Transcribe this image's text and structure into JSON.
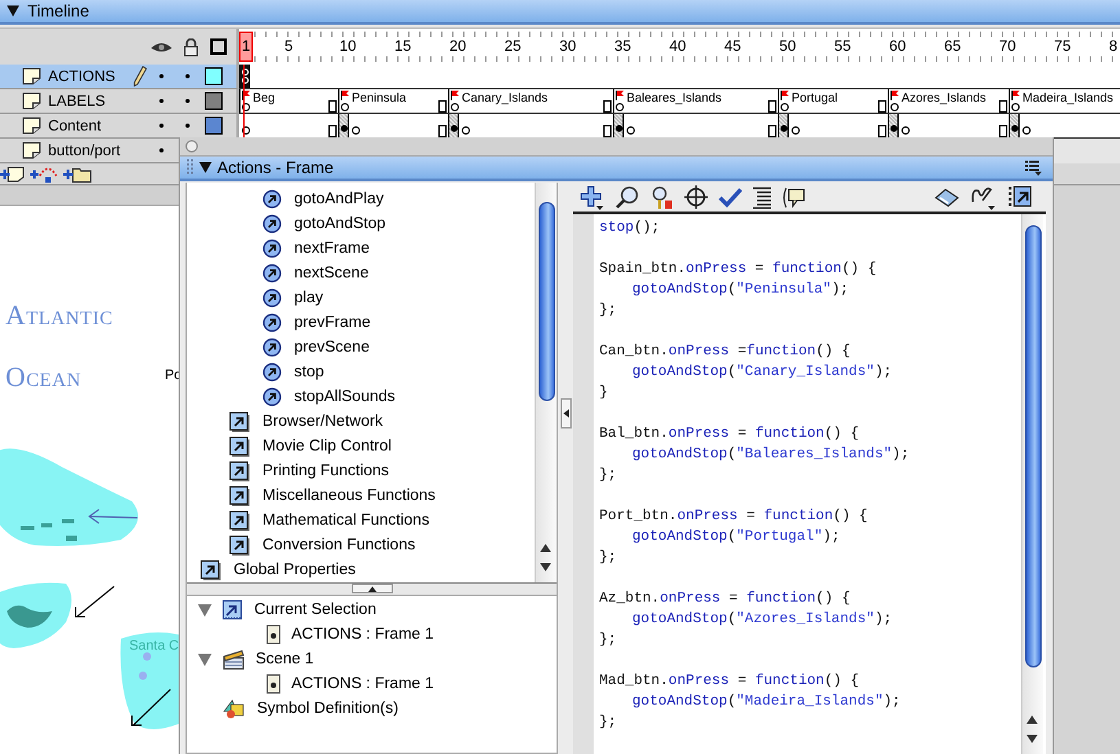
{
  "timeline": {
    "title": "Timeline",
    "ruler": [
      {
        "label": "1",
        "selected": true
      },
      {
        "label": "5",
        "selected": false
      },
      {
        "label": "10",
        "selected": false
      },
      {
        "label": "15",
        "selected": false
      },
      {
        "label": "20",
        "selected": false
      },
      {
        "label": "25",
        "selected": false
      },
      {
        "label": "30",
        "selected": false
      },
      {
        "label": "35",
        "selected": false
      },
      {
        "label": "40",
        "selected": false
      },
      {
        "label": "45",
        "selected": false
      },
      {
        "label": "50",
        "selected": false
      },
      {
        "label": "55",
        "selected": false
      },
      {
        "label": "60",
        "selected": false
      },
      {
        "label": "65",
        "selected": false
      },
      {
        "label": "70",
        "selected": false
      },
      {
        "label": "75",
        "selected": false
      },
      {
        "label": "8",
        "selected": false
      }
    ],
    "layers": [
      {
        "name": "ACTIONS",
        "selected": true,
        "editing": true,
        "covered": false,
        "color": "#80ffff",
        "keyframes": [
          {
            "kind": "action"
          }
        ]
      },
      {
        "name": "LABELS",
        "selected": false,
        "editing": false,
        "covered": false,
        "color": "#808080",
        "keyframes": [
          {
            "kind": "label",
            "label": "Beg"
          },
          {
            "kind": "label",
            "label": "Peninsula"
          },
          {
            "kind": "label",
            "label": "Canary_Islands"
          },
          {
            "kind": "label",
            "label": "Baleares_Islands"
          },
          {
            "kind": "label",
            "label": "Portugal"
          },
          {
            "kind": "label",
            "label": "Azores_Islands"
          },
          {
            "kind": "label",
            "label": "Madeira_Islands"
          }
        ]
      },
      {
        "name": "Content",
        "selected": false,
        "editing": false,
        "covered": false,
        "color": "#5b86d0",
        "keyframes": [
          {
            "kind": "empty"
          },
          {
            "kind": "filled"
          },
          {
            "kind": "empty"
          },
          {
            "kind": "filled"
          },
          {
            "kind": "empty"
          },
          {
            "kind": "filled"
          },
          {
            "kind": "empty"
          },
          {
            "kind": "filled"
          },
          {
            "kind": "empty"
          },
          {
            "kind": "filled"
          },
          {
            "kind": "empty"
          },
          {
            "kind": "filled"
          },
          {
            "kind": "empty"
          }
        ]
      },
      {
        "name": "button/port",
        "selected": false,
        "editing": false,
        "covered": true
      }
    ]
  },
  "stage": {
    "labels": [
      {
        "text": "Atlantic",
        "kind": "ocean"
      },
      {
        "text": "Ocean",
        "kind": "ocean"
      },
      {
        "text": "Po",
        "kind": "place"
      },
      {
        "text": "Santa C",
        "kind": "island"
      }
    ]
  },
  "actions_window": {
    "title": "Actions - Frame",
    "toolbox": [
      {
        "children": [
          {
            "children": [
              {
                "label": "gotoAndPlay",
                "kind": "function"
              },
              {
                "label": "gotoAndStop",
                "kind": "function"
              },
              {
                "label": "nextFrame",
                "kind": "function"
              },
              {
                "label": "nextScene",
                "kind": "function"
              },
              {
                "label": "play",
                "kind": "function"
              },
              {
                "label": "prevFrame",
                "kind": "function"
              },
              {
                "label": "prevScene",
                "kind": "function"
              },
              {
                "label": "stop",
                "kind": "function"
              },
              {
                "label": "stopAllSounds",
                "kind": "function"
              }
            ]
          },
          {
            "label": "Browser/Network",
            "kind": "category"
          },
          {
            "label": "Movie Clip Control",
            "kind": "category"
          },
          {
            "label": "Printing Functions",
            "kind": "category"
          },
          {
            "label": "Miscellaneous Functions",
            "kind": "category"
          },
          {
            "label": "Mathematical Functions",
            "kind": "category"
          },
          {
            "label": "Conversion Functions",
            "kind": "category"
          }
        ]
      },
      {
        "label": "Global Properties",
        "kind": "category"
      }
    ],
    "script_tree": [
      {
        "label": "Current Selection",
        "kind": "selection",
        "expanded": true,
        "children": [
          {
            "label": "ACTIONS : Frame 1",
            "kind": "frame"
          }
        ]
      },
      {
        "label": "Scene 1",
        "kind": "scene",
        "expanded": true,
        "children": [
          {
            "label": "ACTIONS : Frame 1",
            "kind": "frame"
          }
        ]
      },
      {
        "label": "Symbol Definition(s)",
        "kind": "symbols"
      }
    ],
    "code": [
      [
        {
          "indent": false,
          "parts": [
            {
              "text": "stop",
              "kind": "keyword"
            },
            {
              "text": "();",
              "kind": "plain"
            }
          ]
        }
      ],
      [
        {
          "indent": false,
          "parts": [
            {
              "text": "Spain_btn.",
              "kind": "plain"
            },
            {
              "text": "onPress",
              "kind": "keyword"
            },
            {
              "text": " = ",
              "kind": "plain"
            },
            {
              "text": "function",
              "kind": "keyword"
            },
            {
              "text": "() {",
              "kind": "plain"
            }
          ]
        },
        {
          "indent": true,
          "parts": [
            {
              "text": "gotoAndStop",
              "kind": "keyword"
            },
            {
              "text": "(",
              "kind": "plain"
            },
            {
              "text": "\"Peninsula\"",
              "kind": "string"
            },
            {
              "text": ");",
              "kind": "plain"
            }
          ]
        },
        {
          "indent": false,
          "parts": [
            {
              "text": "};",
              "kind": "plain"
            }
          ]
        }
      ],
      [
        {
          "indent": false,
          "parts": [
            {
              "text": "Can_btn.",
              "kind": "plain"
            },
            {
              "text": "onPress",
              "kind": "keyword"
            },
            {
              "text": " =",
              "kind": "plain"
            },
            {
              "text": "function",
              "kind": "keyword"
            },
            {
              "text": "() {",
              "kind": "plain"
            }
          ]
        },
        {
          "indent": true,
          "parts": [
            {
              "text": "gotoAndStop",
              "kind": "keyword"
            },
            {
              "text": "(",
              "kind": "plain"
            },
            {
              "text": "\"Canary_Islands\"",
              "kind": "string"
            },
            {
              "text": ");",
              "kind": "plain"
            }
          ]
        },
        {
          "indent": false,
          "parts": [
            {
              "text": "}",
              "kind": "plain"
            }
          ]
        }
      ],
      [
        {
          "indent": false,
          "parts": [
            {
              "text": "Bal_btn.",
              "kind": "plain"
            },
            {
              "text": "onPress",
              "kind": "keyword"
            },
            {
              "text": " = ",
              "kind": "plain"
            },
            {
              "text": "function",
              "kind": "keyword"
            },
            {
              "text": "() {",
              "kind": "plain"
            }
          ]
        },
        {
          "indent": true,
          "parts": [
            {
              "text": "gotoAndStop",
              "kind": "keyword"
            },
            {
              "text": "(",
              "kind": "plain"
            },
            {
              "text": "\"Baleares_Islands\"",
              "kind": "string"
            },
            {
              "text": ");",
              "kind": "plain"
            }
          ]
        },
        {
          "indent": false,
          "parts": [
            {
              "text": "};",
              "kind": "plain"
            }
          ]
        }
      ],
      [
        {
          "indent": false,
          "parts": [
            {
              "text": "Port_btn.",
              "kind": "plain"
            },
            {
              "text": "onPress",
              "kind": "keyword"
            },
            {
              "text": " = ",
              "kind": "plain"
            },
            {
              "text": "function",
              "kind": "keyword"
            },
            {
              "text": "() {",
              "kind": "plain"
            }
          ]
        },
        {
          "indent": true,
          "parts": [
            {
              "text": "gotoAndStop",
              "kind": "keyword"
            },
            {
              "text": "(",
              "kind": "plain"
            },
            {
              "text": "\"Portugal\"",
              "kind": "string"
            },
            {
              "text": ");",
              "kind": "plain"
            }
          ]
        },
        {
          "indent": false,
          "parts": [
            {
              "text": "};",
              "kind": "plain"
            }
          ]
        }
      ],
      [
        {
          "indent": false,
          "parts": [
            {
              "text": "Az_btn.",
              "kind": "plain"
            },
            {
              "text": "onPress",
              "kind": "keyword"
            },
            {
              "text": " = ",
              "kind": "plain"
            },
            {
              "text": "function",
              "kind": "keyword"
            },
            {
              "text": "() {",
              "kind": "plain"
            }
          ]
        },
        {
          "indent": true,
          "parts": [
            {
              "text": "gotoAndStop",
              "kind": "keyword"
            },
            {
              "text": "(",
              "kind": "plain"
            },
            {
              "text": "\"Azores_Islands\"",
              "kind": "string"
            },
            {
              "text": ");",
              "kind": "plain"
            }
          ]
        },
        {
          "indent": false,
          "parts": [
            {
              "text": "};",
              "kind": "plain"
            }
          ]
        }
      ],
      [
        {
          "indent": false,
          "parts": [
            {
              "text": "Mad_btn.",
              "kind": "plain"
            },
            {
              "text": "onPress",
              "kind": "keyword"
            },
            {
              "text": " = ",
              "kind": "plain"
            },
            {
              "text": "function",
              "kind": "keyword"
            },
            {
              "text": "() {",
              "kind": "plain"
            }
          ]
        },
        {
          "indent": true,
          "parts": [
            {
              "text": "gotoAndStop",
              "kind": "keyword"
            },
            {
              "text": "(",
              "kind": "plain"
            },
            {
              "text": "\"Madeira_Islands\"",
              "kind": "string"
            },
            {
              "text": ");",
              "kind": "plain"
            }
          ]
        },
        {
          "indent": false,
          "parts": [
            {
              "text": "};",
              "kind": "plain"
            }
          ]
        }
      ]
    ]
  }
}
